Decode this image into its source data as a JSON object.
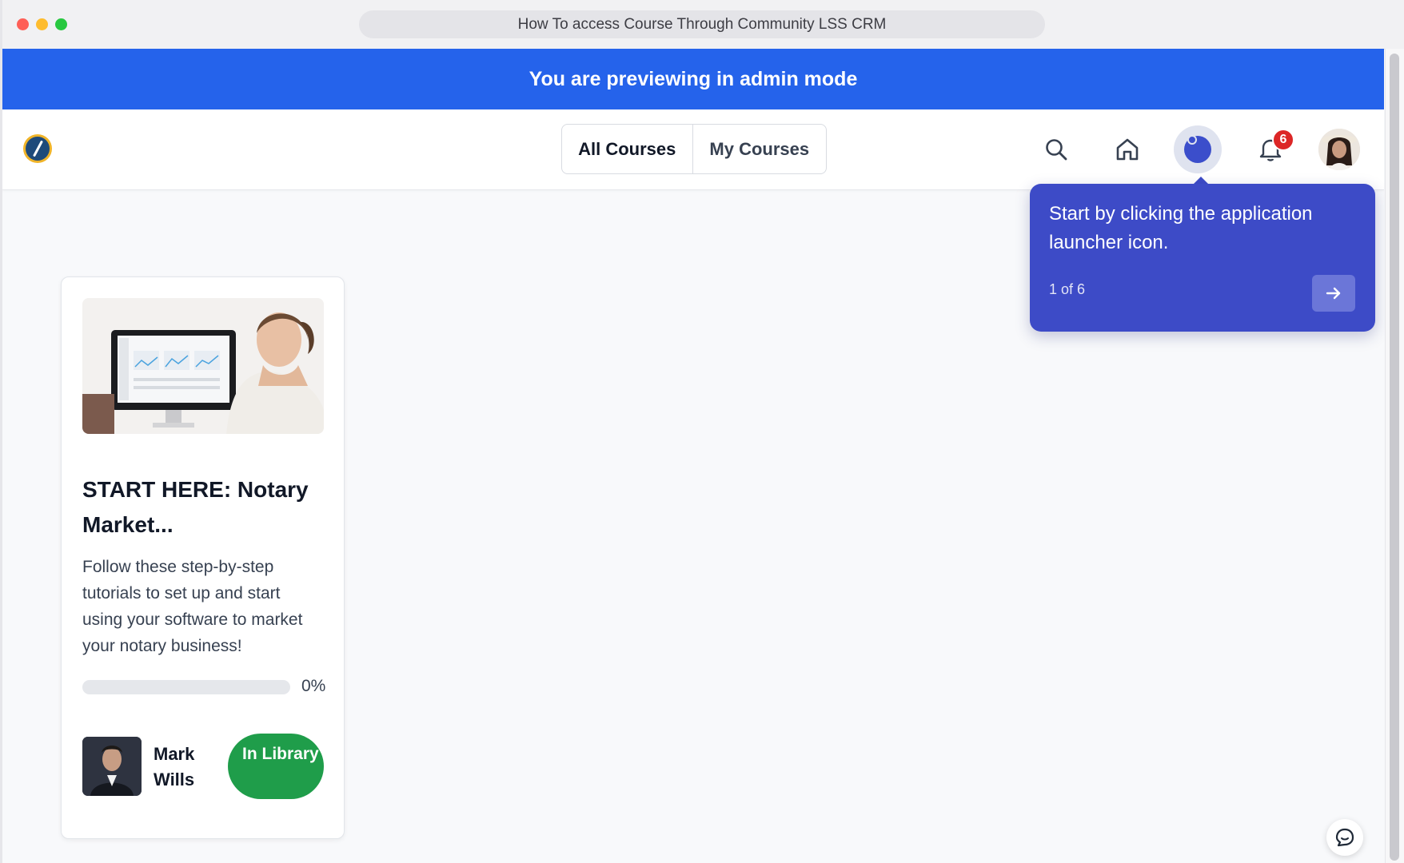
{
  "browser": {
    "url_title": "How To access Course Through Community LSS CRM"
  },
  "banner": {
    "text": "You are previewing in admin mode"
  },
  "nav": {
    "tabs": [
      {
        "label": "All Courses"
      },
      {
        "label": "My Courses"
      }
    ],
    "notification_count": "6",
    "icons": [
      "logo-icon",
      "search-icon",
      "home-icon",
      "app-launcher-icon",
      "bell-icon",
      "user-avatar"
    ]
  },
  "tooltip": {
    "text": "Start by clicking the application launcher icon.",
    "step": "1 of 6"
  },
  "course": {
    "title": "START HERE: Notary Market...",
    "description": "Follow these step-by-step tutorials to set up and start using your software to market your notary business!",
    "progress_label": "0%",
    "progress_fraction": 0,
    "author": "Mark Wills",
    "status_label": "In Library"
  },
  "colors": {
    "banner": "#2563eb",
    "tooltip": "#3d4bc7",
    "library_pill": "#1f9d4a",
    "badge": "#dc2626"
  }
}
